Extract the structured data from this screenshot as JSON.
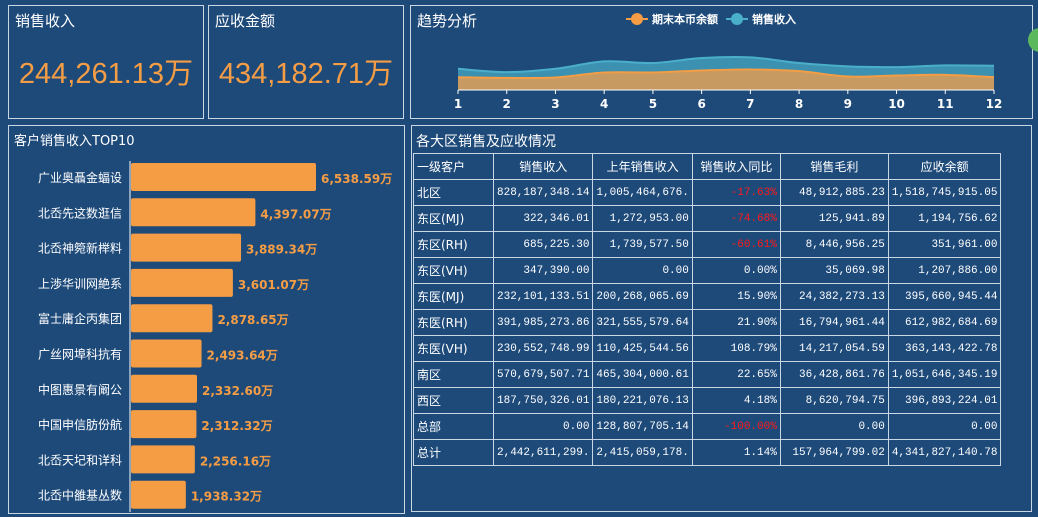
{
  "kpis": [
    {
      "title": "销售收入",
      "value": "244,261.13万"
    },
    {
      "title": "应收金额",
      "value": "434,182.71万"
    }
  ],
  "trend": {
    "title": "趋势分析",
    "legend": [
      "期末本币余额",
      "销售收入"
    ],
    "colors": {
      "balance": "#f49d45",
      "sales": "#4aafc8"
    }
  },
  "chart_data": [
    {
      "type": "area",
      "title": "趋势分析",
      "x": [
        "1",
        "2",
        "3",
        "4",
        "5",
        "6",
        "7",
        "8",
        "9",
        "10",
        "11",
        "12"
      ],
      "series": [
        {
          "name": "期末本币余额",
          "values": [
            38,
            36,
            37,
            52,
            52,
            58,
            61,
            56,
            40,
            43,
            45,
            38
          ]
        },
        {
          "name": "销售收入",
          "values": [
            63,
            53,
            63,
            85,
            80,
            95,
            97,
            80,
            70,
            68,
            73,
            72
          ]
        }
      ],
      "ylim": [
        0,
        190
      ],
      "grid": false,
      "legend": "top-center"
    },
    {
      "type": "bar",
      "title": "客户销售收入TOP10",
      "categories": [
        "广业奥聶金蝠设",
        "北岙先这数逛信",
        "北岙神箢新榉料",
        "上渉华训网絶系",
        "富士庸企丙集团",
        "广丝网埠科抗有",
        "中图惠景有阚公",
        "中国申信肪份航",
        "北岙天圮和详科",
        "北岙中雒基丛数"
      ],
      "values": [
        6538.59,
        4397.07,
        3889.34,
        3601.07,
        2878.65,
        2493.64,
        2332.6,
        2312.32,
        2256.16,
        1938.32
      ],
      "labels": [
        "6,538.59万",
        "4,397.07万",
        "3,889.34万",
        "3,601.07万",
        "2,878.65万",
        "2,493.64万",
        "2,332.60万",
        "2,312.32万",
        "2,256.16万",
        "1,938.32万"
      ],
      "orientation": "horizontal",
      "color": "#f49d45"
    }
  ],
  "table": {
    "title": "各大区销售及应收情况",
    "headers": [
      "一级客户",
      "销售收入",
      "上年销售收入",
      "销售收入同比",
      "销售毛利",
      "应收余额"
    ],
    "rows": [
      [
        "北区",
        "828,187,348.14",
        "1,005,464,676.",
        "-17.63%",
        "48,912,885.23",
        "1,518,745,915.05"
      ],
      [
        "东区(MJ)",
        "322,346.01",
        "1,272,953.00",
        "-74.68%",
        "125,941.89",
        "1,194,756.62"
      ],
      [
        "东区(RH)",
        "685,225.30",
        "1,739,577.50",
        "-60.61%",
        "8,446,956.25",
        "351,961.00"
      ],
      [
        "东区(VH)",
        "347,390.00",
        "0.00",
        "0.00%",
        "35,069.98",
        "1,207,886.00"
      ],
      [
        "东医(MJ)",
        "232,101,133.51",
        "200,268,065.69",
        "15.90%",
        "24,382,273.13",
        "395,660,945.44"
      ],
      [
        "东医(RH)",
        "391,985,273.86",
        "321,555,579.64",
        "21.90%",
        "16,794,961.44",
        "612,982,684.69"
      ],
      [
        "东医(VH)",
        "230,552,748.99",
        "110,425,544.56",
        "108.79%",
        "14,217,054.59",
        "363,143,422.78"
      ],
      [
        "南区",
        "570,679,507.71",
        "465,304,000.61",
        "22.65%",
        "36,428,861.76",
        "1,051,646,345.19"
      ],
      [
        "西区",
        "187,750,326.01",
        "180,221,076.13",
        "4.18%",
        "8,620,794.75",
        "396,893,224.01"
      ],
      [
        "总部",
        "0.00",
        "128,807,705.14",
        "-100.00%",
        "0.00",
        "0.00"
      ],
      [
        "总计",
        "2,442,611,299.",
        "2,415,059,178.",
        "1.14%",
        "157,964,799.02",
        "4,341,827,140.78"
      ]
    ]
  }
}
